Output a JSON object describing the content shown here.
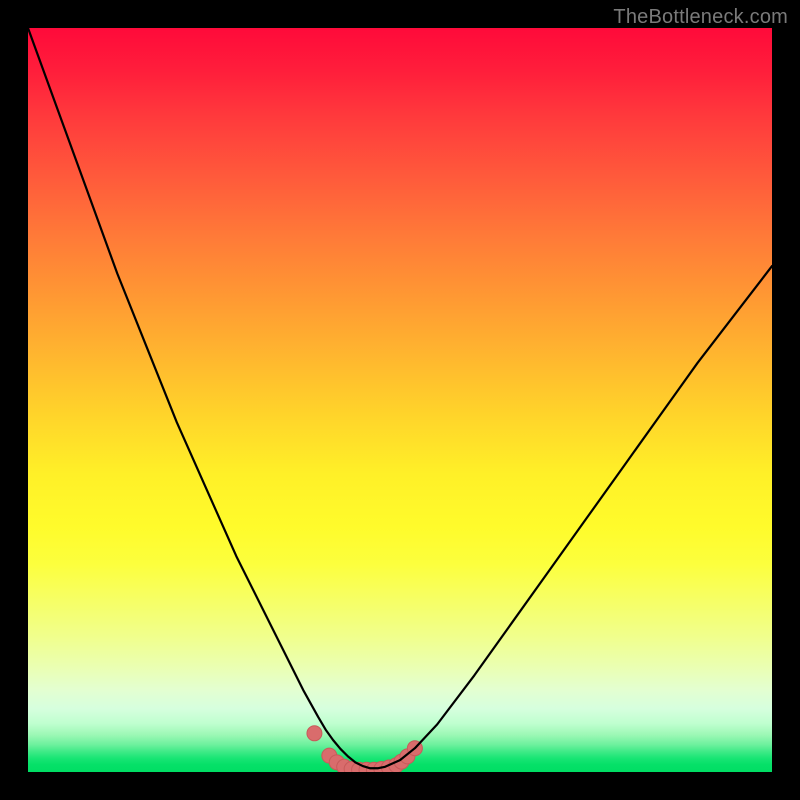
{
  "watermark": {
    "text": "TheBottleneck.com"
  },
  "colors": {
    "frame": "#000000",
    "curve_stroke": "#000000",
    "marker_fill": "#d96c6c",
    "marker_stroke": "#c85a5a",
    "gradient_top": "#ff0a3a",
    "gradient_mid": "#fff028",
    "gradient_bottom": "#00de64",
    "watermark": "#7a7a7a"
  },
  "chart_data": {
    "type": "line",
    "title": "",
    "xlabel": "",
    "ylabel": "",
    "xlim": [
      0,
      100
    ],
    "ylim": [
      0,
      100
    ],
    "grid": false,
    "legend": false,
    "series": [
      {
        "name": "bottleneck-curve",
        "x": [
          0,
          4,
          8,
          12,
          16,
          20,
          24,
          28,
          32,
          34,
          36,
          37,
          38,
          39,
          40,
          41,
          42,
          43,
          44,
          45,
          46,
          47,
          48,
          50,
          52,
          55,
          60,
          65,
          70,
          75,
          80,
          85,
          90,
          95,
          100
        ],
        "y": [
          100,
          89,
          78,
          67,
          57,
          47,
          38,
          29,
          21,
          17,
          13,
          11,
          9.2,
          7.4,
          5.7,
          4.3,
          3.1,
          2.1,
          1.3,
          0.8,
          0.5,
          0.5,
          0.7,
          1.6,
          3.2,
          6.4,
          13,
          20,
          27,
          34,
          41,
          48,
          55,
          61.5,
          68
        ]
      }
    ],
    "markers": {
      "name": "floor-markers",
      "x": [
        38.5,
        40.5,
        41.5,
        42.5,
        43.5,
        44.5,
        45.5,
        46.5,
        47.5,
        48.5,
        49.5,
        50.2,
        51,
        52
      ],
      "y": [
        5.2,
        2.2,
        1.3,
        0.7,
        0.4,
        0.3,
        0.3,
        0.3,
        0.4,
        0.6,
        0.9,
        1.4,
        2.1,
        3.2
      ]
    }
  }
}
